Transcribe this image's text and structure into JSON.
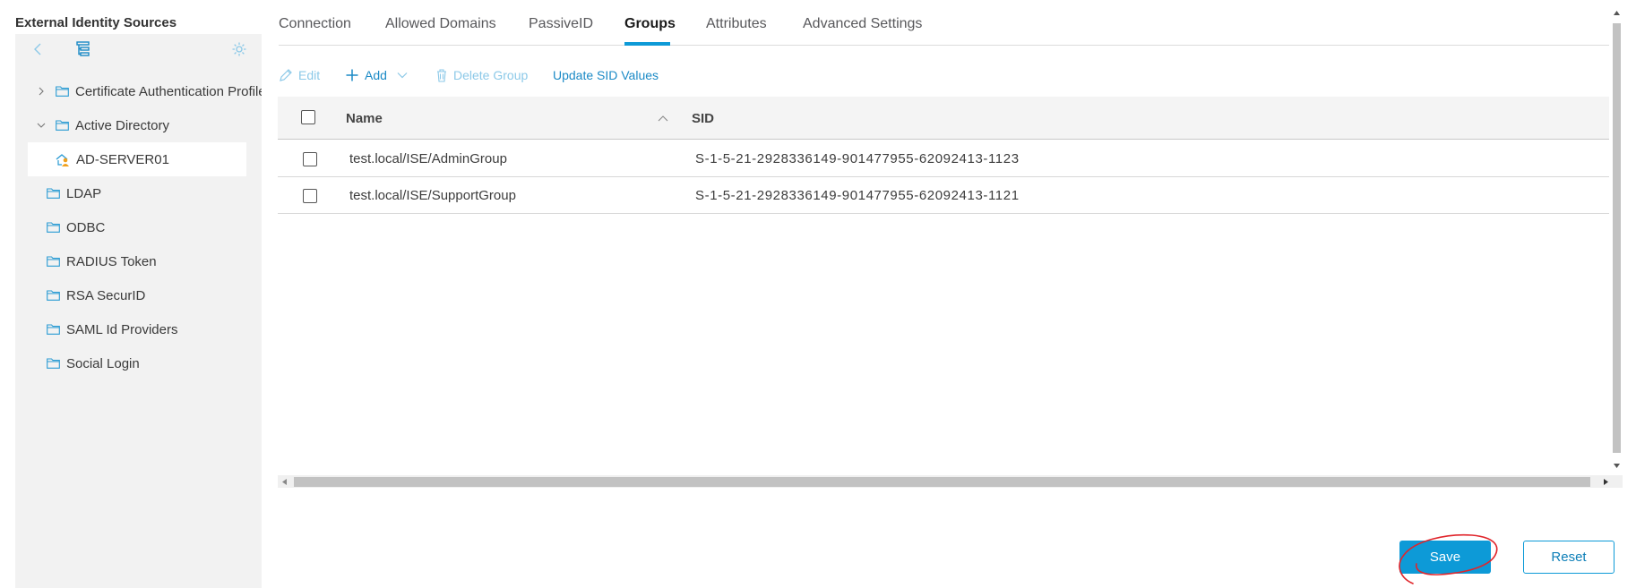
{
  "sidebar": {
    "title": "External Identity Sources",
    "icons": {
      "back": "chevron-left-icon",
      "tree": "tree-view-icon",
      "settings": "gear-icon"
    },
    "items": [
      {
        "label": "Certificate Authentication Profile",
        "expander": "chevron-right"
      },
      {
        "label": "Active Directory",
        "expander": "chevron-down"
      },
      {
        "label": "AD-SERVER01",
        "selected": true
      },
      {
        "label": "LDAP"
      },
      {
        "label": "ODBC"
      },
      {
        "label": "RADIUS Token"
      },
      {
        "label": "RSA SecurID"
      },
      {
        "label": "SAML Id Providers"
      },
      {
        "label": "Social Login"
      }
    ]
  },
  "tabs": [
    {
      "label": "Connection"
    },
    {
      "label": "Allowed Domains"
    },
    {
      "label": "PassiveID"
    },
    {
      "label": "Groups",
      "active": true
    },
    {
      "label": "Attributes"
    },
    {
      "label": "Advanced Settings"
    }
  ],
  "toolbar": {
    "edit": "Edit",
    "add": "Add",
    "delete_group": "Delete Group",
    "update_sid": "Update SID Values"
  },
  "table": {
    "columns": {
      "name": "Name",
      "sid": "SID"
    },
    "rows": [
      {
        "name": "test.local/ISE/AdminGroup",
        "sid": "S-1-5-21-2928336149-901477955-62092413-1123"
      },
      {
        "name": "test.local/ISE/SupportGroup",
        "sid": "S-1-5-21-2928336149-901477955-62092413-1121"
      }
    ]
  },
  "actions": {
    "save": "Save",
    "reset": "Reset"
  },
  "colors": {
    "accent": "#0d9ad7",
    "sidebar_bg": "#f2f2f2",
    "annotation": "#e0252b"
  }
}
